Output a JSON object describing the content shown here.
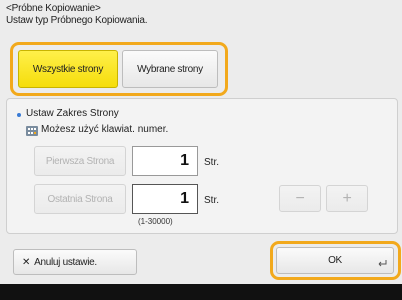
{
  "header": {
    "title": "<Próbne Kopiowanie>",
    "subtitle": "Ustaw typ Próbnego Kopiowania."
  },
  "type_buttons": {
    "all_pages": "Wszystkie strony",
    "selected_pages": "Wybrane strony",
    "selected": "all_pages"
  },
  "range": {
    "heading": "Ustaw Zakres Strony",
    "hint": "Możesz użyć klawiat. numer.",
    "first_page_label": "Pierwsza Strona",
    "first_page_value": "1",
    "last_page_label": "Ostatnia Strona",
    "last_page_value": "1",
    "unit": "Str.",
    "range_hint": "(1-30000)",
    "minus": "−",
    "plus": "+"
  },
  "footer": {
    "cancel_label": "Anuluj ustawie.",
    "ok_label": "OK"
  },
  "colors": {
    "highlight": "#f2a91c",
    "selected": "#f5dd0b",
    "accent_bullet": "#3a7bd5"
  },
  "icons": {
    "keypad": "keypad-icon",
    "cancel": "x-icon",
    "ok_enter": "enter-icon"
  }
}
